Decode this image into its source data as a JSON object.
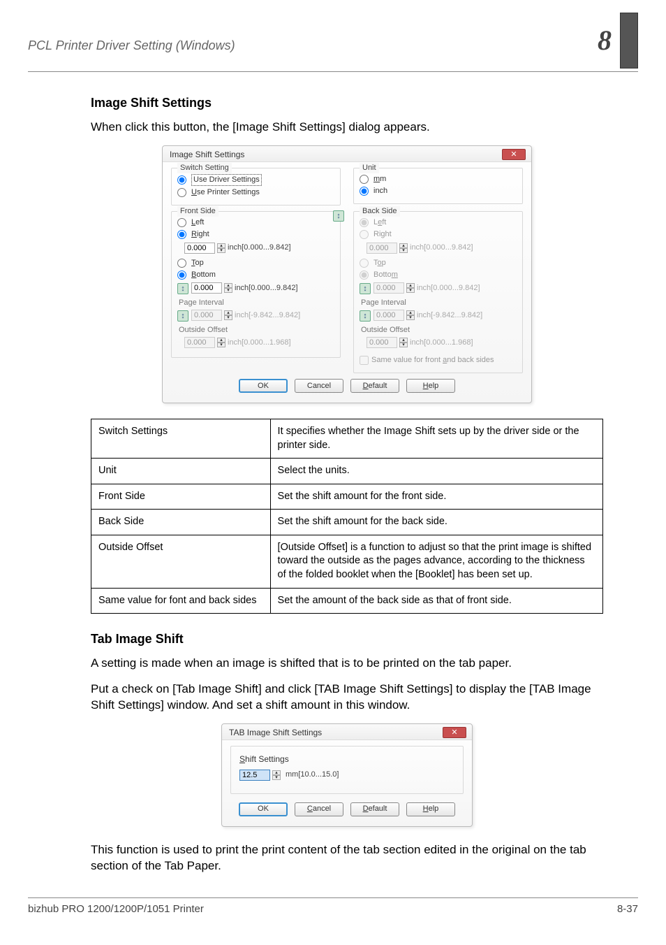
{
  "header": {
    "left": "PCL Printer Driver Setting (Windows)",
    "chapter": "8"
  },
  "section_image_shift": {
    "title": "Image Shift Settings",
    "intro": "When click this button, the [Image Shift Settings] dialog appears."
  },
  "dialog_image_shift": {
    "title": "Image Shift Settings",
    "switch": {
      "legend": "Switch Setting",
      "opt1": "Use Driver Settings",
      "opt2": "Use Printer Settings"
    },
    "unit": {
      "legend": "Unit",
      "opt1": "mm",
      "opt2": "inch"
    },
    "front": {
      "legend": "Front Side",
      "left": "Left",
      "right": "Right",
      "val1": "0.000",
      "range1": "inch[0.000...9.842]",
      "top": "Top",
      "bottom": "Bottom",
      "val2": "0.000",
      "range2": "inch[0.000...9.842]",
      "page_interval": "Page Interval",
      "val3": "0.000",
      "range3": "inch[-9.842...9.842]",
      "outside_offset": "Outside Offset",
      "val4": "0.000",
      "range4": "inch[0.000...1.968]"
    },
    "back": {
      "legend": "Back Side",
      "left": "Left",
      "right": "Right",
      "val1": "0.000",
      "range1": "inch[0.000...9.842]",
      "top": "Top",
      "bottom": "Bottom",
      "val2": "0.000",
      "range2": "inch[0.000...9.842]",
      "page_interval": "Page Interval",
      "val3": "0.000",
      "range3": "inch[-9.842...9.842]",
      "outside_offset": "Outside Offset",
      "val4": "0.000",
      "range4": "inch[0.000...1.968]"
    },
    "same_both": "Same value for front and back sides",
    "buttons": {
      "ok": "OK",
      "cancel": "Cancel",
      "default": "Default",
      "help": "Help"
    }
  },
  "table_image_shift": {
    "rows": [
      {
        "label": "Switch Settings",
        "desc": "It specifies whether the Image Shift sets up by the driver side or the printer side."
      },
      {
        "label": "Unit",
        "desc": "Select the units."
      },
      {
        "label": "Front Side",
        "desc": "Set the shift amount for the front side."
      },
      {
        "label": "Back Side",
        "desc": "Set the shift amount for the back side."
      },
      {
        "label": "Outside Offset",
        "desc": "[Outside Offset] is a function to adjust so that the print image is shifted toward the outside as the pages advance, according to the thickness of the folded booklet when the [Booklet] has been set up."
      },
      {
        "label": "Same value for font and back sides",
        "desc": "Set the amount of the back side as that of front side."
      }
    ]
  },
  "section_tab": {
    "title": "Tab Image Shift",
    "p1": "A setting is made when an image is shifted that is to be printed on the tab paper.",
    "p2": "Put a check on [Tab Image Shift] and click [TAB Image Shift Settings] to display the [TAB Image Shift Settings] window. And set a shift amount in this window.",
    "p3": "This function is used to print the print content of the tab section edited in the original on the tab section of the Tab Paper."
  },
  "dialog_tab": {
    "title": "TAB Image Shift Settings",
    "shift_label": "Shift Settings",
    "value": "12.5",
    "range": "mm[10.0...15.0]",
    "buttons": {
      "ok": "OK",
      "cancel": "Cancel",
      "default": "Default",
      "help": "Help"
    }
  },
  "footer": {
    "left": "bizhub PRO 1200/1200P/1051 Printer",
    "right": "8-37"
  }
}
